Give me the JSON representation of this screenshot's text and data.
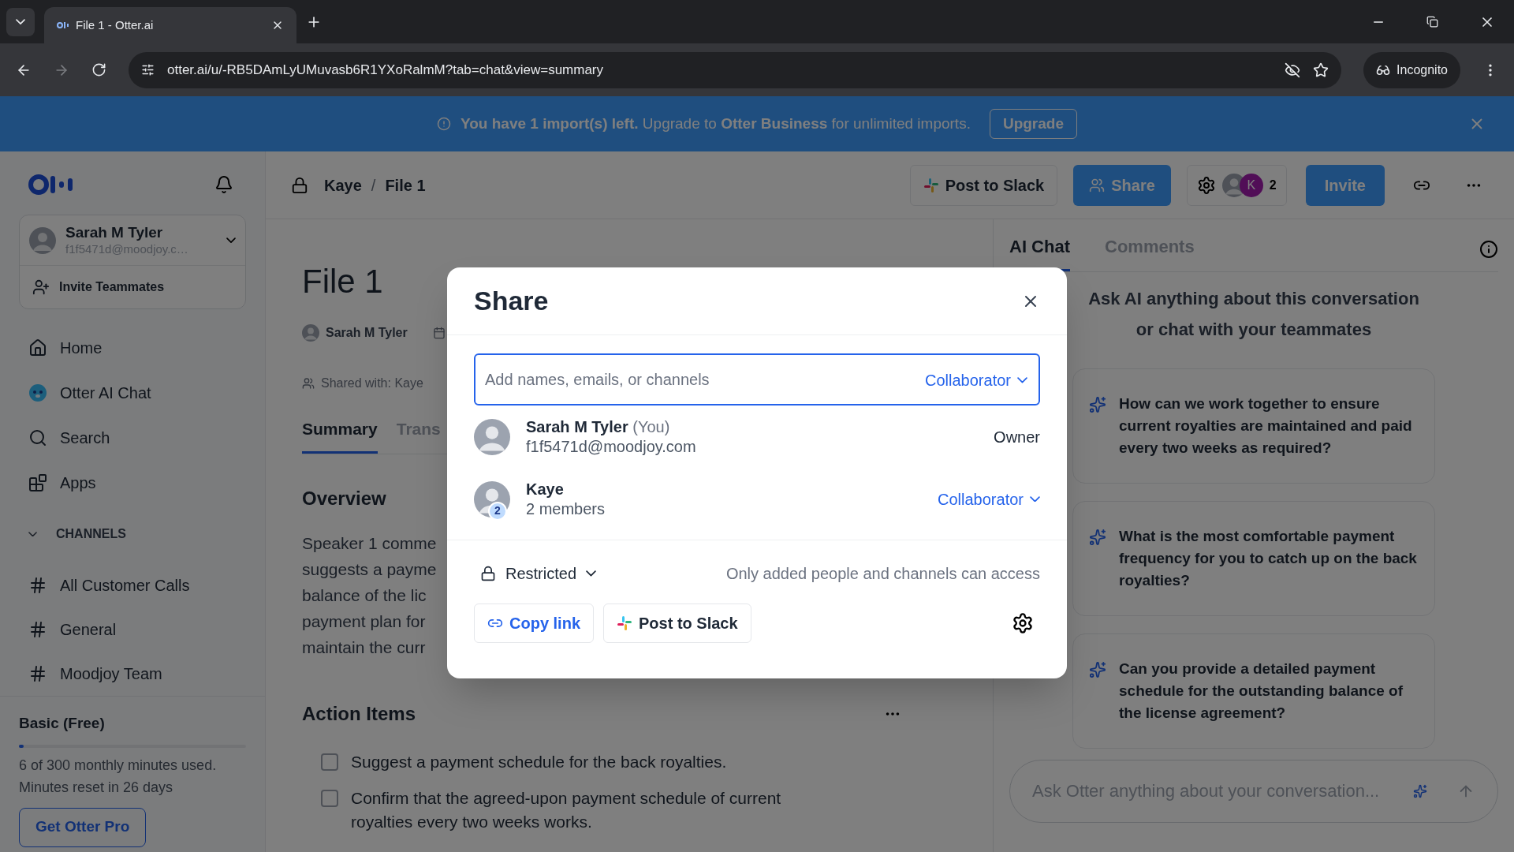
{
  "browser": {
    "tab_title": "File 1 - Otter.ai",
    "url": "otter.ai/u/-RB5DAmLyUMuvasb6R1YXoRalmM?tab=chat&view=summary",
    "profile": "Incognito"
  },
  "banner": {
    "message": "**You have 1 import(s) left.** Upgrade to **Otter Business** for unlimited imports.",
    "button": "Upgrade"
  },
  "header": {
    "breadcrumb": [
      "Kaye",
      "File 1"
    ],
    "separator": "/",
    "post_to_slack": "Post to Slack",
    "share": "Share",
    "member_initial": "K",
    "member_count": "2",
    "invite": "Invite"
  },
  "sidebar": {
    "user": {
      "name": "Sarah M Tyler",
      "email": "f1f5471d@moodjoy.c…"
    },
    "invite": "Invite Teammates",
    "nav": [
      {
        "label": "Home",
        "kind": "home"
      },
      {
        "label": "Otter AI Chat",
        "kind": "otter"
      },
      {
        "label": "Search",
        "kind": "search"
      },
      {
        "label": "Apps",
        "kind": "apps"
      }
    ],
    "channels_heading": "CHANNELS",
    "channels_expanded": true,
    "channels": [
      "All Customer Calls",
      "General",
      "Moodjoy Team"
    ],
    "plan": {
      "name": "Basic (Free)",
      "level": 0.02,
      "usage": "6 of 300 monthly minutes used.",
      "reset": "Minutes reset in 26 days",
      "button": "Get Otter Pro"
    }
  },
  "document": {
    "title": "File 1",
    "owner": "Sarah M Tyler",
    "shared_with": "Shared with: Kaye",
    "tabs": [
      {
        "label": "Summary",
        "selected": true
      },
      {
        "label": "Trans",
        "selected": false
      }
    ],
    "overview_heading": "Overview",
    "overview_lines": [
      "Speaker 1 comme",
      "suggests a payme",
      "balance of the lic",
      "payment plan for",
      "maintain the curr"
    ],
    "action_heading": "Action Items",
    "action_items": [
      {
        "text": "Suggest a payment schedule for the back royalties.",
        "checked": false
      },
      {
        "text": "Confirm that the agreed-upon payment schedule of current royalties every two weeks works.",
        "checked": false
      }
    ]
  },
  "right_panel": {
    "tabs": [
      {
        "label": "AI Chat",
        "selected": true
      },
      {
        "label": "Comments",
        "selected": false
      }
    ],
    "intro": "Ask AI anything about this conversation or chat with your teammates",
    "suggestions": [
      "How can we work together to ensure current royalties are maintained and paid every two weeks as required?",
      "What is the most comfortable payment frequency for you to catch up on the back royalties?",
      "Can you provide a detailed payment schedule for the outstanding balance of the license agreement?"
    ],
    "input_placeholder": "Ask Otter anything about your conversation..."
  },
  "share_dialog": {
    "title": "Share",
    "input_placeholder": "Add names, emails, or channels",
    "default_role": "Collaborator",
    "people": [
      {
        "name": "Sarah M Tyler",
        "note": "(You)",
        "detail": "f1f5471d@moodjoy.com",
        "role": "Owner",
        "kind": "fixed"
      },
      {
        "name": "Kaye",
        "detail": "2 members",
        "badge": "2",
        "role": "Collaborator",
        "kind": "dropdown"
      }
    ],
    "access": "Restricted",
    "access_description": "Only added people and channels can access",
    "buttons": [
      {
        "label": "Copy link",
        "kind": "link"
      },
      {
        "label": "Post to Slack",
        "kind": "slack"
      }
    ]
  }
}
